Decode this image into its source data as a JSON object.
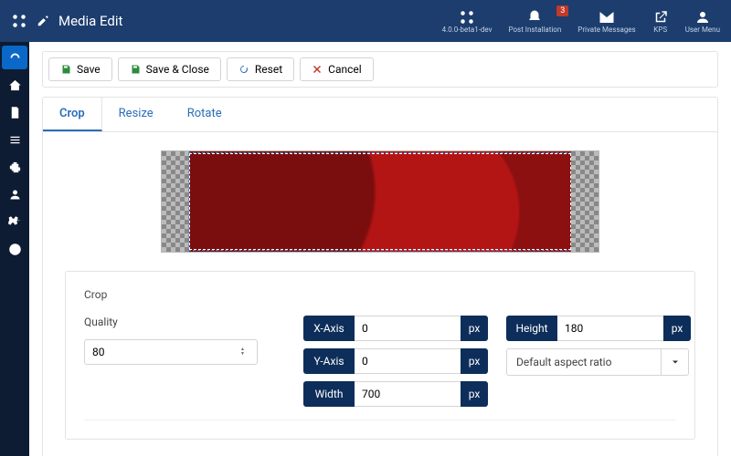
{
  "header": {
    "title": "Media Edit",
    "version": "4.0.0-beta1-dev",
    "nav": {
      "post_install": "Post Installation",
      "private_msgs": "Private Messages",
      "kps": "KPS",
      "user_menu": "User Menu",
      "notif_count": "3"
    }
  },
  "toolbar": {
    "save": "Save",
    "save_close": "Save & Close",
    "reset": "Reset",
    "cancel": "Cancel"
  },
  "tabs": {
    "crop": "Crop",
    "resize": "Resize",
    "rotate": "Rotate"
  },
  "crop": {
    "legend": "Crop",
    "quality_label": "Quality",
    "quality_value": "80",
    "x_axis_label": "X-Axis",
    "x_axis_value": "0",
    "y_axis_label": "Y-Axis",
    "y_axis_value": "0",
    "width_label": "Width",
    "width_value": "700",
    "height_label": "Height",
    "height_value": "180",
    "unit": "px",
    "aspect_ratio": "Default aspect ratio"
  }
}
